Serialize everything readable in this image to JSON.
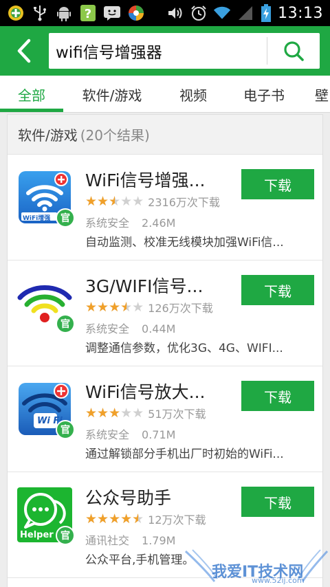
{
  "status_bar": {
    "time": "13:13",
    "left_icons": [
      "notification-plus-icon",
      "usb-icon",
      "android-icon",
      "help-question-icon",
      "chat-smiley-icon",
      "app-store-icon"
    ],
    "right_icons": [
      "volume-icon",
      "alarm-icon",
      "wifi-icon",
      "signal-icon",
      "battery-charging-icon"
    ]
  },
  "header": {
    "search_value": "wifi信号增强器",
    "accent_color": "#1fa843"
  },
  "tabs": [
    {
      "label": "全部",
      "active": true
    },
    {
      "label": "软件/游戏",
      "active": false
    },
    {
      "label": "视频",
      "active": false
    },
    {
      "label": "电子书",
      "active": false
    },
    {
      "label": "壁",
      "active": false
    }
  ],
  "section": {
    "title": "软件/游戏",
    "count": "(20个结果)"
  },
  "apps": [
    {
      "name": "WiFi信号增强...",
      "rating": 2.5,
      "downloads": "2316万次下载",
      "category": "系统安全",
      "size": "2.46M",
      "description": "自动监测、校准无线模块加强WiFi信...",
      "button": "下载",
      "badge": "官",
      "icon_text": "WiFi增强"
    },
    {
      "name": "3G/WIFI信号...",
      "rating": 3.5,
      "downloads": "126万次下载",
      "category": "系统安全",
      "size": "0.44M",
      "description": "调整通信参数，优化3G、4G、WIFI...",
      "button": "下载",
      "badge": "官"
    },
    {
      "name": "WiFi信号放大...",
      "rating": 3,
      "downloads": "51万次下载",
      "category": "系统安全",
      "size": "0.71M",
      "description": "通过解锁部分手机出厂时初始的WiFi...",
      "button": "下载",
      "badge": "官",
      "icon_text": "Wi Fi"
    },
    {
      "name": "公众号助手",
      "rating": 4.5,
      "downloads": "12万次下载",
      "category": "通讯社交",
      "size": "1.79M",
      "description": "公众平台,手机管理。",
      "button": "下载",
      "badge": "官",
      "icon_text": "Helper"
    }
  ],
  "watermark": {
    "text": "我爱IT技术网",
    "sub": "www.52ij.com"
  }
}
